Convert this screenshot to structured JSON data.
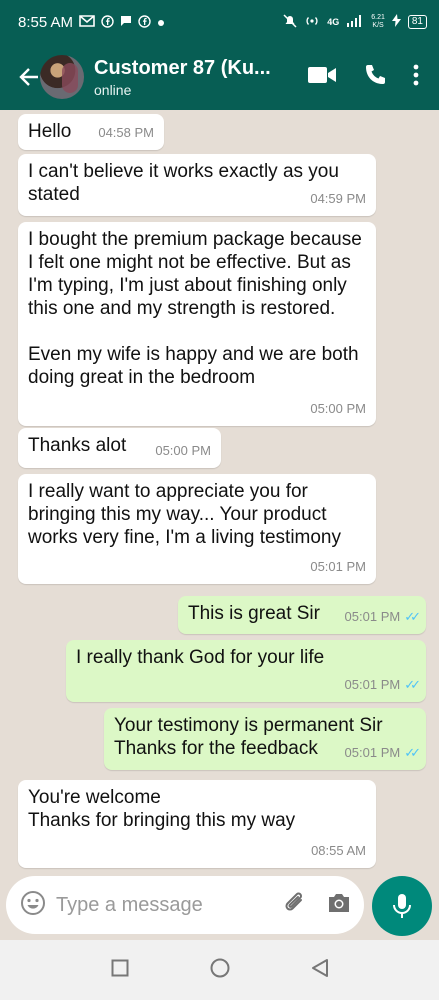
{
  "status_bar": {
    "time": "8:55 AM",
    "network": "4G",
    "net_speed_value": "6.21",
    "net_speed_unit": "K/S",
    "battery": "81"
  },
  "header": {
    "contact_name": "Customer 87 (Ku...",
    "status": "online"
  },
  "messages": [
    {
      "direction": "in",
      "text": "Hello",
      "time": "04:58 PM"
    },
    {
      "direction": "in",
      "text": "I can't believe it works exactly as you stated",
      "time": "04:59 PM"
    },
    {
      "direction": "in",
      "text": "I bought the premium package because I felt one might not be effective. But as I'm typing, I'm just about finishing only this one and my strength is restored.\n\nEven my wife is happy and we are both doing great in the bedroom",
      "time": "05:00 PM"
    },
    {
      "direction": "in",
      "text": "Thanks alot",
      "time": "05:00 PM"
    },
    {
      "direction": "in",
      "text": "I really want to appreciate you for bringing this my way... Your product works very fine, I'm a living testimony",
      "time": "05:01 PM"
    },
    {
      "direction": "out",
      "text": "This is great Sir",
      "time": "05:01 PM"
    },
    {
      "direction": "out",
      "text": "I really thank God for your life",
      "time": "05:01 PM"
    },
    {
      "direction": "out",
      "text": "Your testimony is permanent Sir\nThanks for the feedback",
      "time": "05:01 PM"
    },
    {
      "direction": "in",
      "text": "You're welcome\nThanks for bringing this my way",
      "time": "08:55 AM"
    }
  ],
  "composer": {
    "placeholder": "Type a message"
  },
  "colors": {
    "header": "#075e54",
    "incoming": "#ffffff",
    "outgoing": "#dcf8c6",
    "mic": "#00897b",
    "read_tick": "#4fc3f7"
  }
}
